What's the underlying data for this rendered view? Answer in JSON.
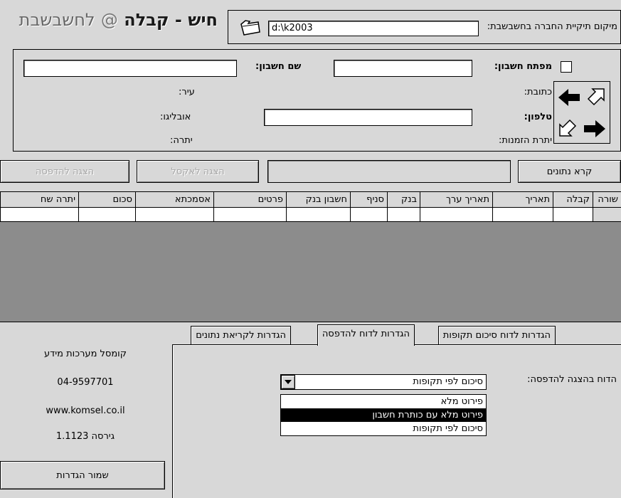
{
  "header": {
    "title_main": "חיש - קבלה",
    "title_at": "@",
    "title_suffix": "לחשבשבת",
    "company_path_label": "מיקום תיקיית החברה בחשבשבת:",
    "company_path_value": "d:\\k2003"
  },
  "account": {
    "key_label": "מפתח חשבון:",
    "key_value": "",
    "name_label": "שם חשבון:",
    "name_value": "",
    "address_label": "כתובת:",
    "city_label": "עיר:",
    "phone_label": "טלפון:",
    "phone_value": "",
    "zip_label": "אובליגו:",
    "order_balance_label": "יתרת הזמנות:",
    "balance_label": "יתרה:"
  },
  "actions": {
    "read_data": "קרא נתונים",
    "status_value": "",
    "show_excel": "הצגה לאקסל",
    "show_print": "הצגה להדפסה"
  },
  "grid": {
    "columns": [
      "שורה",
      "קבלה",
      "תאריך",
      "תאריך ערך",
      "בנק",
      "סניף",
      "חשבון בנק",
      "פרטים",
      "אסמכתא",
      "סכום",
      "יתרה שח"
    ]
  },
  "tabs": {
    "items": [
      "הגדרות לדוח סיכום תקופות",
      "הגדרות לדוח להדפסה",
      "הגדרות לקריאת נתונים"
    ],
    "active_index": 1
  },
  "report": {
    "label": "הדוח בהצגה להדפסה:",
    "selected": "סיכום לפי תקופות",
    "options": [
      "פירוט מלא",
      "פירוט מלא עם כותרת חשבון",
      "סיכום לפי תקופות"
    ],
    "highlighted_index": 1
  },
  "company": {
    "name": "קומסל מערכות מידע",
    "phone": "04-9597701",
    "website": "www.komsel.co.il",
    "version": "גירסה 1.1123"
  },
  "footer": {
    "save_settings": "שמור הגדרות"
  }
}
